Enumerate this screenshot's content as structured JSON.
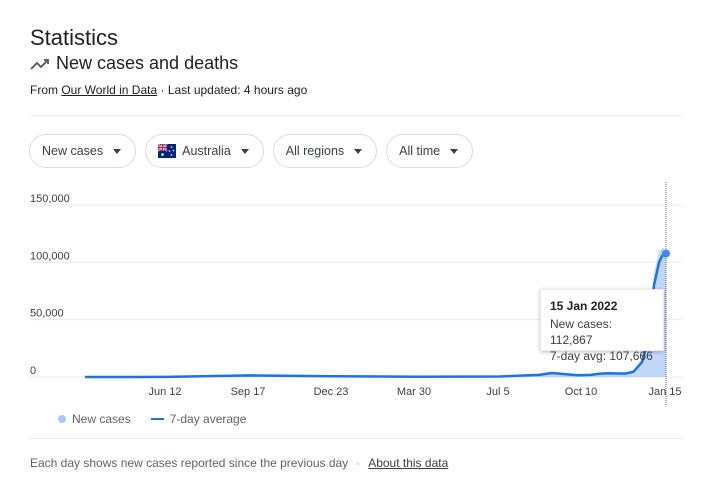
{
  "header": {
    "title": "Statistics"
  },
  "section": {
    "title": "New cases and deaths",
    "icon": "trending-up-icon",
    "source_prefix": "From ",
    "source_link": "Our World in Data",
    "last_updated": " · Last updated: 4 hours ago"
  },
  "filters": [
    {
      "label": "New cases"
    },
    {
      "label": "Australia",
      "icon": "australia-flag-icon"
    },
    {
      "label": "All regions"
    },
    {
      "label": "All time"
    }
  ],
  "tooltip": {
    "date": "15 Jan 2022",
    "new_cases": "New cases: 112,867",
    "avg": "7-day avg: 107,666"
  },
  "legend": {
    "new_cases": "New cases",
    "avg": "7-day average"
  },
  "footer": {
    "note": "Each day shows new cases reported since the previous day",
    "sep": "·",
    "about": "About this data"
  },
  "colors": {
    "series_line": "#1a73e8",
    "series_fill": "#a8c7fa"
  },
  "chart_data": {
    "type": "area",
    "x_tick_labels": [
      "Jun 12",
      "Sep 17",
      "Dec 23",
      "Mar 30",
      "Jul 5",
      "Oct 10",
      "Jan 15"
    ],
    "y_tick_labels": [
      "0",
      "50,000",
      "100,000",
      "150,000"
    ],
    "y_ticks": [
      0,
      50000,
      100000,
      150000
    ],
    "ylim": [
      0,
      170000
    ],
    "x_range_days": [
      0,
      590
    ],
    "x_tick_days": [
      96,
      193,
      290,
      387,
      484,
      581,
      678
    ],
    "series": [
      {
        "name": "New cases",
        "points": [
          [
            0,
            0
          ],
          [
            96,
            100
          ],
          [
            193,
            1500
          ],
          [
            290,
            600
          ],
          [
            387,
            300
          ],
          [
            484,
            400
          ],
          [
            530,
            2000
          ],
          [
            545,
            4000
          ],
          [
            560,
            2500
          ],
          [
            575,
            1500
          ],
          [
            590,
            1800
          ],
          [
            600,
            3000
          ],
          [
            610,
            3500
          ],
          [
            630,
            3000
          ],
          [
            640,
            5000
          ],
          [
            650,
            15000
          ],
          [
            658,
            40000
          ],
          [
            664,
            90000
          ],
          [
            670,
            110000
          ],
          [
            675,
            112867
          ],
          [
            678,
            108000
          ]
        ]
      },
      {
        "name": "7-day average",
        "points": [
          [
            0,
            0
          ],
          [
            96,
            100
          ],
          [
            193,
            1400
          ],
          [
            290,
            600
          ],
          [
            387,
            300
          ],
          [
            484,
            400
          ],
          [
            530,
            1800
          ],
          [
            545,
            3500
          ],
          [
            560,
            2500
          ],
          [
            575,
            1500
          ],
          [
            590,
            1800
          ],
          [
            600,
            2800
          ],
          [
            610,
            3300
          ],
          [
            630,
            3000
          ],
          [
            640,
            4500
          ],
          [
            650,
            13000
          ],
          [
            658,
            35000
          ],
          [
            664,
            80000
          ],
          [
            670,
            100000
          ],
          [
            675,
            107666
          ],
          [
            678,
            107666
          ]
        ]
      }
    ],
    "highlight": {
      "x": "Jan 15",
      "y": 107666
    },
    "grid": true
  }
}
